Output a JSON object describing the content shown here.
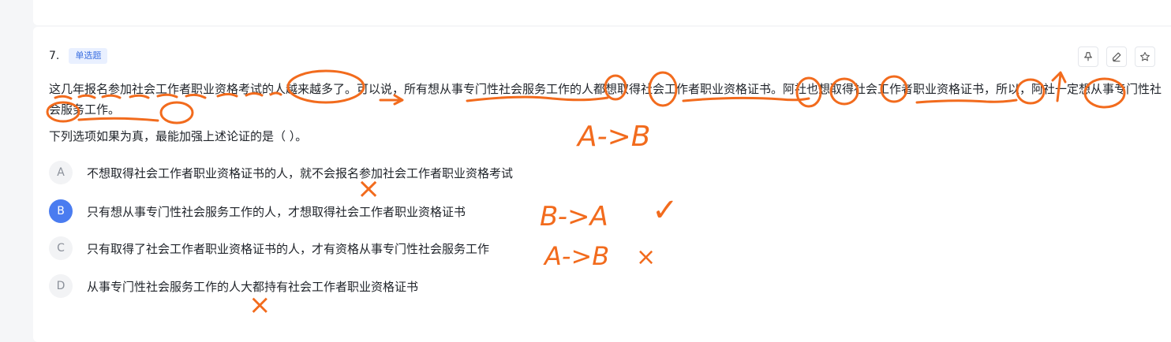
{
  "question": {
    "number": "7.",
    "type_tag": "单选题",
    "stem": "这几年报名参加社会工作者职业资格考试的人越来越多了。可以说，所有想从事专门性社会服务工作的人都想取得社会工作者职业资格证书。阿社也想取得社会工作者职业资格证书，所以，阿社一定想从事专门性社会服务工作。",
    "prompt": "下列选项如果为真，最能加强上述论证的是（ ）。"
  },
  "toolbar": {
    "icons": [
      "pin-icon",
      "edit-icon",
      "star-icon"
    ]
  },
  "options": [
    {
      "letter": "A",
      "text": "不想取得社会工作者职业资格证书的人，就不会报名参加社会工作者职业资格考试",
      "selected": false
    },
    {
      "letter": "B",
      "text": "只有想从事专门性社会服务工作的人，才想取得社会工作者职业资格证书",
      "selected": true
    },
    {
      "letter": "C",
      "text": "只有取得了社会工作者职业资格证书的人，才有资格从事专门性社会服务工作",
      "selected": false
    },
    {
      "letter": "D",
      "text": "从事专门性社会服务工作的人大都持有社会工作者职业资格证书",
      "selected": false
    }
  ],
  "annotations": {
    "ink_color": "#f26b1d",
    "notes": [
      "A->B",
      "B->A",
      "A->B"
    ],
    "marks": [
      "×",
      "✓",
      "×",
      "×"
    ]
  }
}
